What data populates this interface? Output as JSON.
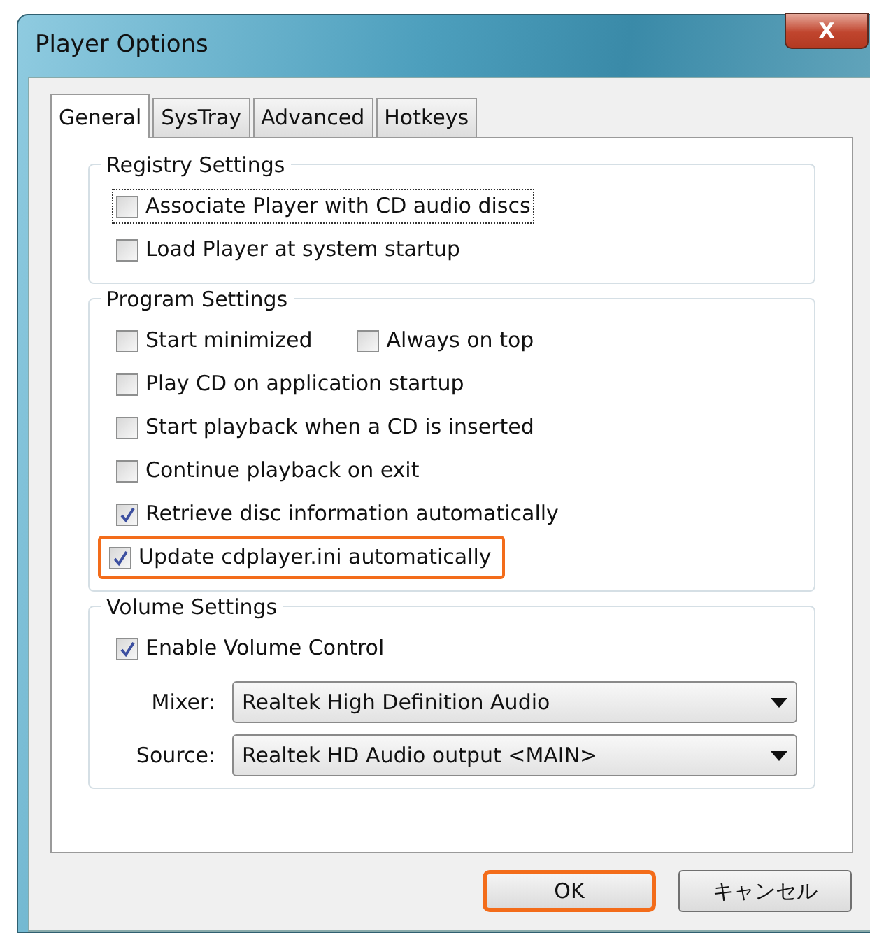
{
  "window": {
    "title": "Player Options",
    "close": "X"
  },
  "tabs": [
    {
      "label": "General",
      "selected": true
    },
    {
      "label": "SysTray",
      "selected": false
    },
    {
      "label": "Advanced",
      "selected": false
    },
    {
      "label": "Hotkeys",
      "selected": false
    }
  ],
  "groups": [
    {
      "title": "Registry Settings",
      "rows": [
        [
          {
            "label": "Associate Player with CD audio discs",
            "checked": false,
            "focused": true,
            "highlighted": false
          }
        ],
        [
          {
            "label": "Load Player at system startup",
            "checked": false,
            "focused": false,
            "highlighted": false
          }
        ]
      ]
    },
    {
      "title": "Program Settings",
      "rows": [
        [
          {
            "label": "Start minimized",
            "checked": false,
            "focused": false,
            "highlighted": false
          },
          {
            "label": "Always on top",
            "checked": false,
            "focused": false,
            "highlighted": false
          }
        ],
        [
          {
            "label": "Play CD on application startup",
            "checked": false,
            "focused": false,
            "highlighted": false
          }
        ],
        [
          {
            "label": "Start playback when a CD is inserted",
            "checked": false,
            "focused": false,
            "highlighted": false
          }
        ],
        [
          {
            "label": "Continue playback on exit",
            "checked": false,
            "focused": false,
            "highlighted": false
          }
        ],
        [
          {
            "label": "Retrieve disc information automatically",
            "checked": true,
            "focused": false,
            "highlighted": false
          }
        ],
        [
          {
            "label": "Update cdplayer.ini automatically",
            "checked": true,
            "focused": false,
            "highlighted": true
          }
        ]
      ]
    },
    {
      "title": "Volume Settings",
      "rows": [
        [
          {
            "label": "Enable Volume Control",
            "checked": true,
            "focused": false,
            "highlighted": false
          }
        ]
      ],
      "selects": [
        {
          "label": "Mixer:",
          "value": "Realtek High Definition Audio"
        },
        {
          "label": "Source:",
          "value": "Realtek HD Audio output <MAIN>"
        }
      ]
    }
  ],
  "buttons": [
    {
      "label": "OK",
      "highlighted": true
    },
    {
      "label": "キャンセル",
      "highlighted": false
    }
  ]
}
